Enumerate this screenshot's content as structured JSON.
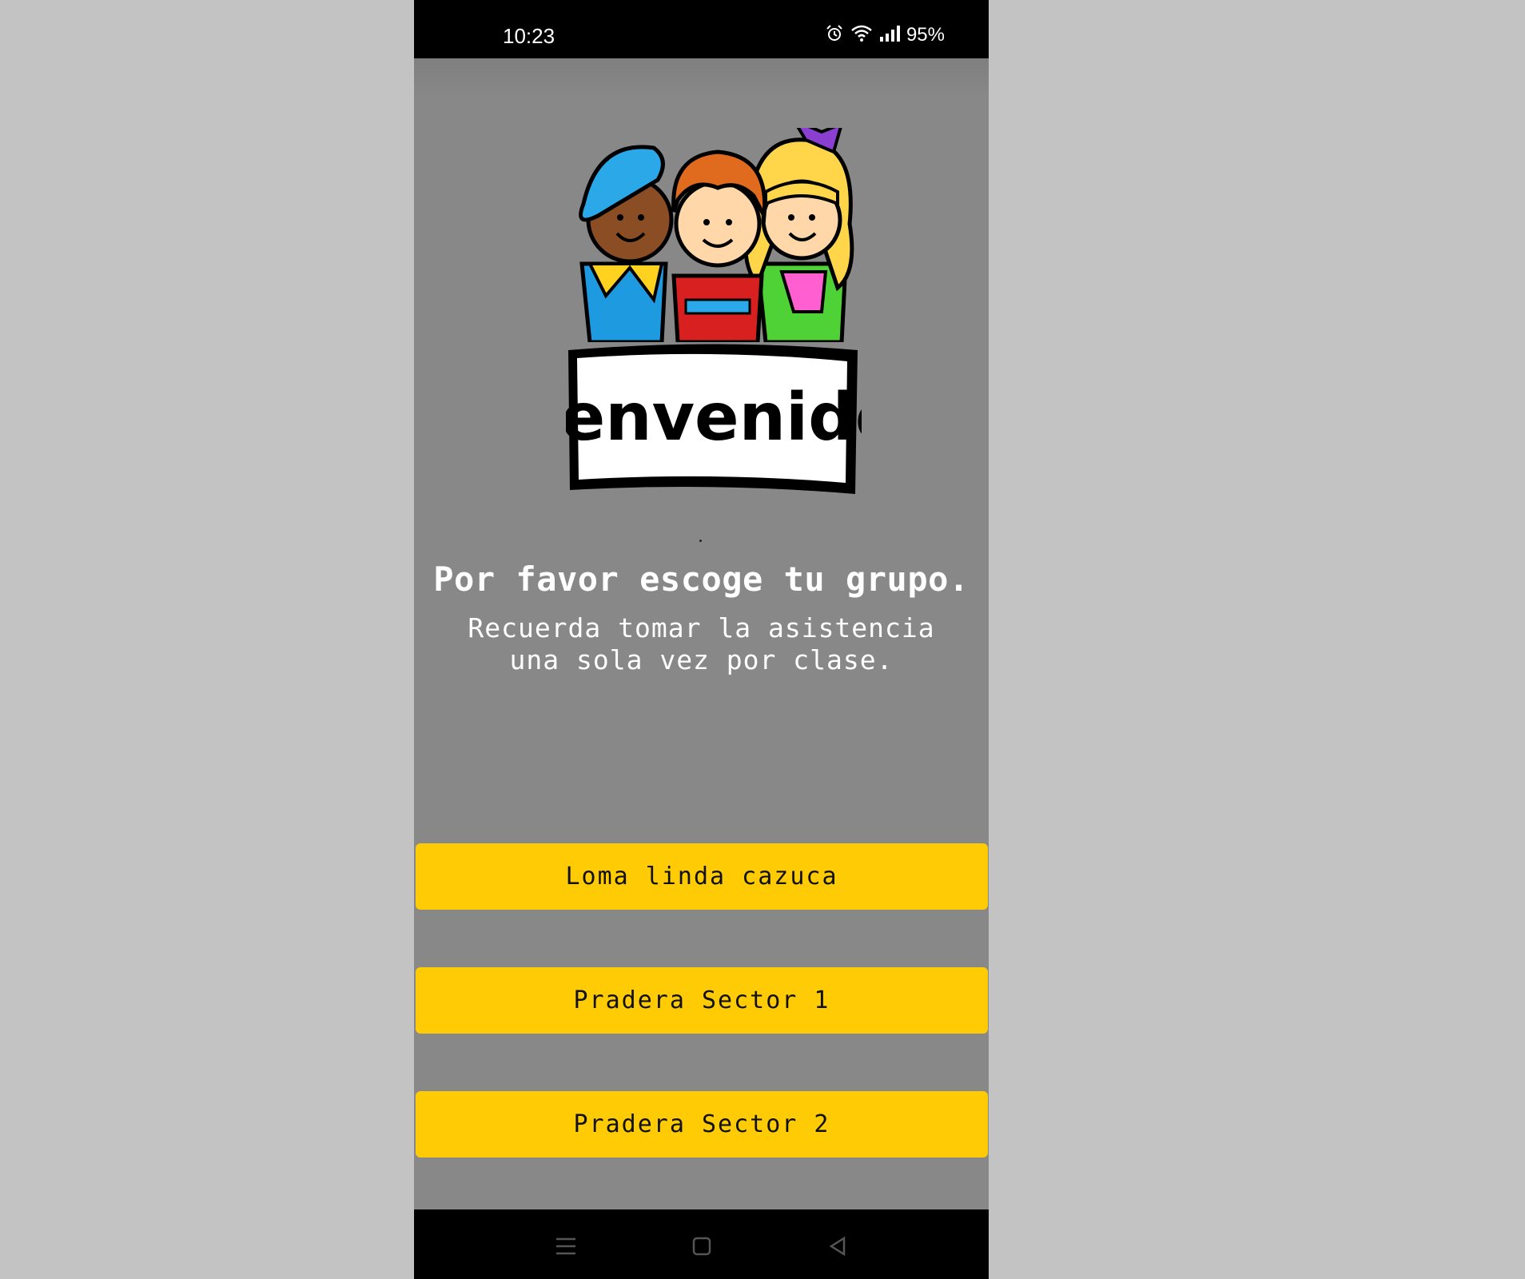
{
  "status_bar": {
    "time": "10:23",
    "battery": "95%",
    "icons": [
      "alarm-icon",
      "wifi-icon",
      "signal-icon"
    ]
  },
  "welcome_image": {
    "sign_text": "Bienvenidos"
  },
  "main": {
    "heading": "Por favor escoge tu grupo.",
    "subtext": "Recuerda tomar la asistencia una sola vez por clase."
  },
  "groups": [
    {
      "label": "Loma linda cazuca"
    },
    {
      "label": "Pradera Sector 1"
    },
    {
      "label": "Pradera Sector 2"
    }
  ],
  "navigation": {
    "icons": [
      "recent-apps-icon",
      "home-icon",
      "back-icon"
    ]
  },
  "colors": {
    "background": "#888888",
    "button": "#fecb04",
    "outer": "#c3c3c3"
  }
}
